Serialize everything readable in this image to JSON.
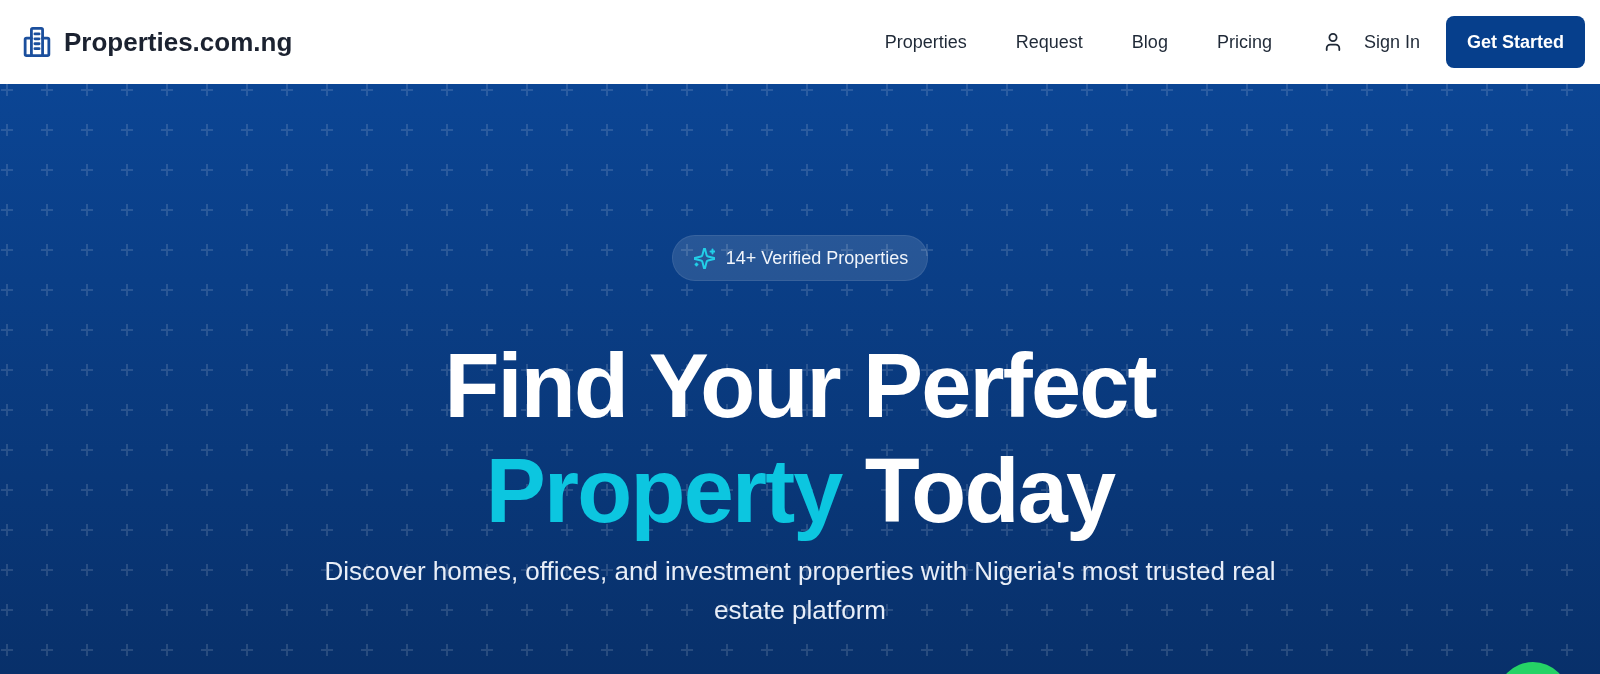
{
  "header": {
    "logo": "Properties.com.ng",
    "nav": [
      "Properties",
      "Request",
      "Blog",
      "Pricing"
    ],
    "sign_in": "Sign In",
    "cta": "Get Started"
  },
  "hero": {
    "badge": "14+ Verified Properties",
    "heading": {
      "before": "Find Your Perfect",
      "highlight": "Property",
      "after": "Today"
    },
    "subtitle": "Discover homes, offices, and investment properties with Nigeria's most trusted real estate platform"
  }
}
